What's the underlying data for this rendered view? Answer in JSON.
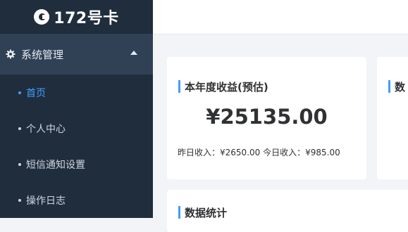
{
  "logo": {
    "text": "172号卡"
  },
  "sidebar": {
    "group_label": "系统管理",
    "items": [
      {
        "label": "首页",
        "active": true
      },
      {
        "label": "个人中心",
        "active": false
      },
      {
        "label": "短信通知设置",
        "active": false
      },
      {
        "label": "操作日志",
        "active": false
      }
    ]
  },
  "cards": {
    "revenue": {
      "title": "本年度收益(预估)",
      "amount": "¥25135.00",
      "yesterday_label": "昨日收入：",
      "yesterday_value": "¥2650.00",
      "today_label": "今日收入：",
      "today_value": "¥985.00"
    },
    "second": {
      "title": "数"
    },
    "stats": {
      "title": "数据统计"
    }
  },
  "colors": {
    "sidebar_bg": "#1f2d3d",
    "menu_group_bg": "#304156",
    "accent": "#409eff",
    "page_bg": "#f3f4f7"
  }
}
